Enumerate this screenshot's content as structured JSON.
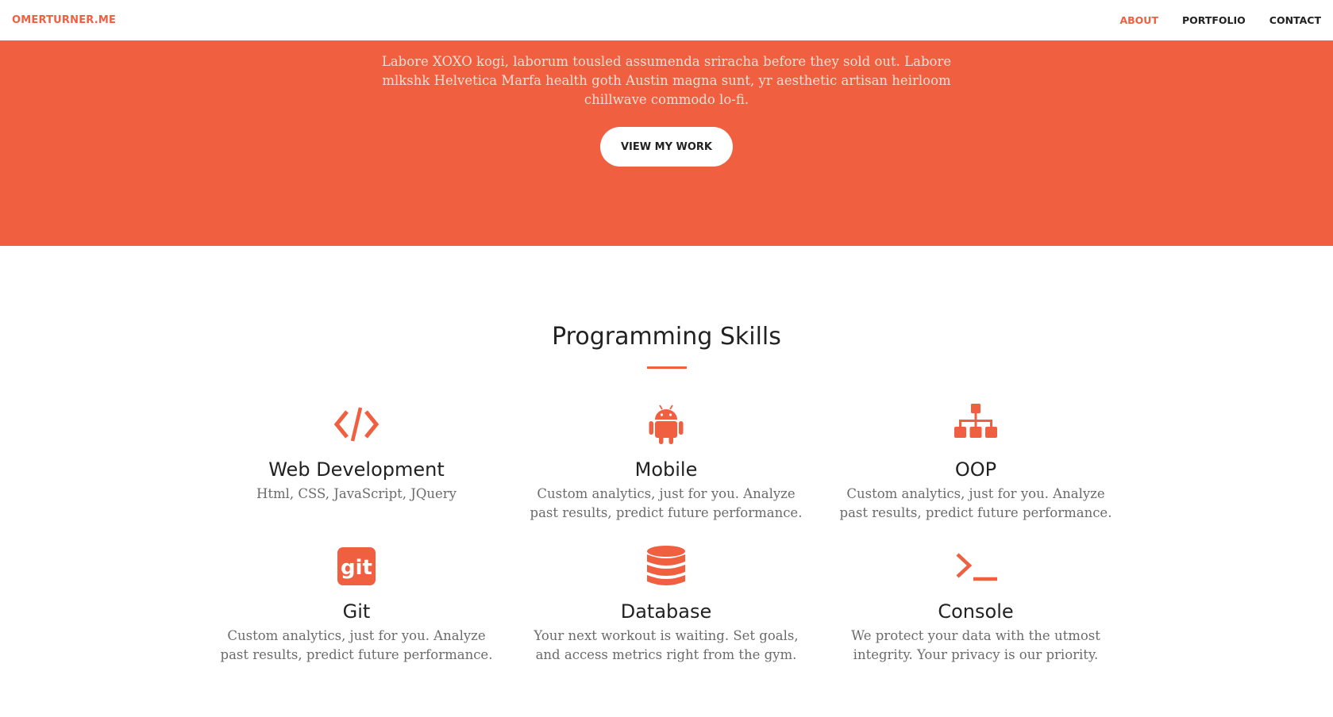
{
  "navbar": {
    "brand": "OMERTURNER.ME",
    "links": [
      {
        "label": "ABOUT",
        "active": true
      },
      {
        "label": "PORTFOLIO",
        "active": false
      },
      {
        "label": "CONTACT",
        "active": false
      }
    ]
  },
  "hero": {
    "text": "Labore XOXO kogi, laborum tousled assumenda sriracha before they sold out. Labore mlkshk Helvetica Marfa health goth Austin magna sunt, yr aesthetic artisan heirloom chillwave commodo lo-fi.",
    "button_label": "VIEW MY WORK"
  },
  "skills": {
    "heading": "Programming Skills",
    "items": [
      {
        "icon": "code-icon",
        "title": "Web Development",
        "text": "Html, CSS, JavaScript, JQuery"
      },
      {
        "icon": "android-icon",
        "title": "Mobile",
        "text": "Custom analytics, just for you. Analyze past results, predict future performance."
      },
      {
        "icon": "sitemap-icon",
        "title": "OOP",
        "text": "Custom analytics, just for you. Analyze past results, predict future performance."
      },
      {
        "icon": "git-icon",
        "title": "Git",
        "text": "Custom analytics, just for you. Analyze past results, predict future performance."
      },
      {
        "icon": "database-icon",
        "title": "Database",
        "text": "Your next workout is waiting. Set goals, and access metrics right from the gym."
      },
      {
        "icon": "terminal-icon",
        "title": "Console",
        "text": "We protect your data with the utmost integrity. Your privacy is our priority."
      }
    ]
  },
  "colors": {
    "accent": "#f05f40",
    "text_dark": "#222222",
    "text_muted": "#6b6b6b"
  }
}
